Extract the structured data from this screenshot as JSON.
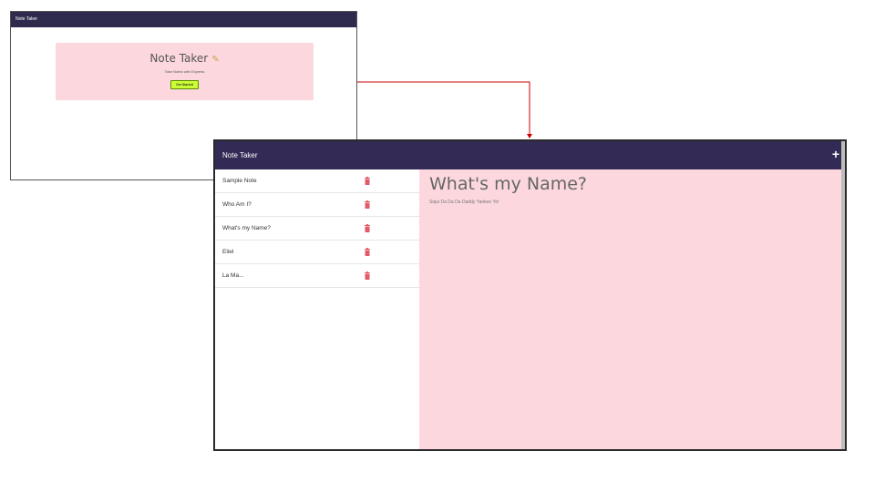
{
  "landing": {
    "navbar_title": "Note Taker",
    "heading": "Note Taker",
    "pencil_icon": "pencil-icon",
    "lead": "Take Notes with Express",
    "start_button": "Get Started"
  },
  "app": {
    "brand": "Note Taker",
    "new_note_label": "+",
    "notes": [
      {
        "title": "Sample Note"
      },
      {
        "title": "Who Am I?"
      },
      {
        "title": "What's my Name?"
      },
      {
        "title": "Eliel"
      },
      {
        "title": "La Ma..."
      }
    ],
    "active_note": {
      "title": "What's my Name?",
      "body": "Siqui Da Da Da Daddy Yankee Yo!"
    }
  },
  "colors": {
    "navbar": "#332a55",
    "jumbotron": "#fcd8de",
    "button": "#ccff33",
    "trash": "#e05a6a",
    "arrow": "#cc0000"
  }
}
